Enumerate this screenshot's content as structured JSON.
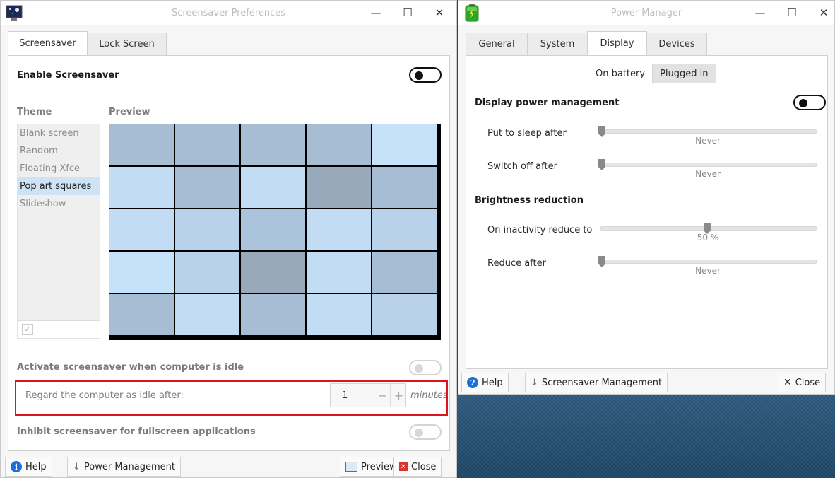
{
  "screensaver_window": {
    "title": "Screensaver Preferences",
    "tabs": [
      {
        "label": "Screensaver",
        "active": true
      },
      {
        "label": "Lock Screen",
        "active": false
      }
    ],
    "enable_label": "Enable Screensaver",
    "enable_on": true,
    "theme_header": "Theme",
    "preview_header": "Preview",
    "themes": [
      "Blank screen",
      "Random",
      "Floating Xfce",
      "Pop art squares",
      "Slideshow"
    ],
    "selected_theme": "Pop art squares",
    "preview_colors": [
      [
        "#a7bdd4",
        "#a7bdd4",
        "#a7bdd4",
        "#a7bdd4",
        "#c6e2fb"
      ],
      [
        "#c2dcf3",
        "#a7bdd4",
        "#c2dcf3",
        "#97a9bb",
        "#a7bdd4"
      ],
      [
        "#c2dcf3",
        "#b9d1e9",
        "#abc3db",
        "#c2dcf3",
        "#b9d1e9"
      ],
      [
        "#c6e2fb",
        "#b9d1e9",
        "#97a9bb",
        "#c2dcf3",
        "#a7bdd4"
      ],
      [
        "#a7bdd4",
        "#c2dcf3",
        "#a7bdd4",
        "#c2dcf3",
        "#b9d1e9"
      ]
    ],
    "activate_label": "Activate screensaver when computer is idle",
    "activate_on": false,
    "idle_label": "Regard the computer as idle after:",
    "idle_value": "1",
    "idle_unit": "minutes",
    "inhibit_label": "Inhibit screensaver for fullscreen applications",
    "inhibit_on": false,
    "buttons": {
      "help": "Help",
      "power_management": "Power Management",
      "preview": "Preview",
      "close": "Close"
    }
  },
  "power_window": {
    "title": "Power Manager",
    "tabs": [
      {
        "label": "General",
        "active": false
      },
      {
        "label": "System",
        "active": false
      },
      {
        "label": "Display",
        "active": true
      },
      {
        "label": "Devices",
        "active": false
      }
    ],
    "segment": [
      {
        "label": "On battery",
        "active": false
      },
      {
        "label": "Plugged in",
        "active": true
      }
    ],
    "dpm_label": "Display power management",
    "dpm_on": true,
    "sleep_label": "Put to sleep after",
    "sleep_value": "Never",
    "sleep_level": 0,
    "switchoff_label": "Switch off after",
    "switchoff_value": "Never",
    "switchoff_level": 0,
    "brightness_header": "Brightness reduction",
    "inactivity_label": "On inactivity reduce to",
    "inactivity_value": "50 %",
    "inactivity_level": 0.49,
    "reduce_label": "Reduce after",
    "reduce_value": "Never",
    "reduce_level": 0,
    "buttons": {
      "help": "Help",
      "screensaver_management": "Screensaver Management",
      "close": "Close"
    }
  },
  "colors": {
    "highlight": "#e0121b",
    "selection": "#cfe3f7",
    "help_blue": "#1e6fd9"
  }
}
